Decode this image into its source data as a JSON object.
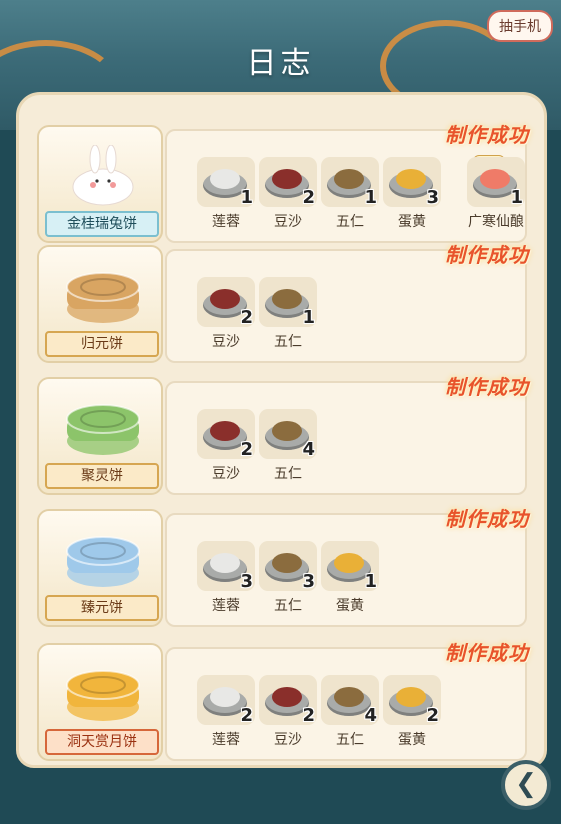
{
  "header": {
    "title": "日志",
    "phone_button": "抽手机"
  },
  "success_label": "制作成功",
  "extra_label": "额外",
  "rows": [
    {
      "cake": "金桂瑞兔饼",
      "label_style": "blue",
      "cake_icon": "rabbit-cake-icon",
      "items": [
        {
          "name": "莲蓉",
          "count": "1",
          "color": "#e8e8e6"
        },
        {
          "name": "豆沙",
          "count": "2",
          "color": "#8a2f2b"
        },
        {
          "name": "五仁",
          "count": "1",
          "color": "#8b6c3e"
        },
        {
          "name": "蛋黄",
          "count": "3",
          "color": "#e9b037"
        }
      ],
      "extra": {
        "name": "广寒仙酿",
        "count": "1",
        "color": "#ef7b68"
      }
    },
    {
      "cake": "归元饼",
      "label_style": "gold",
      "cake_icon": "mooncake-brown-icon",
      "items": [
        {
          "name": "豆沙",
          "count": "2",
          "color": "#8a2f2b"
        },
        {
          "name": "五仁",
          "count": "1",
          "color": "#8b6c3e"
        }
      ]
    },
    {
      "cake": "聚灵饼",
      "label_style": "gold",
      "cake_icon": "mooncake-green-icon",
      "items": [
        {
          "name": "豆沙",
          "count": "2",
          "color": "#8a2f2b"
        },
        {
          "name": "五仁",
          "count": "4",
          "color": "#8b6c3e"
        }
      ]
    },
    {
      "cake": "臻元饼",
      "label_style": "gold",
      "cake_icon": "mooncake-blue-icon",
      "items": [
        {
          "name": "莲蓉",
          "count": "3",
          "color": "#e8e8e6"
        },
        {
          "name": "五仁",
          "count": "3",
          "color": "#8b6c3e"
        },
        {
          "name": "蛋黄",
          "count": "1",
          "color": "#e9b037"
        }
      ]
    },
    {
      "cake": "洞天赏月饼",
      "label_style": "red",
      "cake_icon": "mooncake-golden-icon",
      "items": [
        {
          "name": "莲蓉",
          "count": "2",
          "color": "#e8e8e6"
        },
        {
          "name": "豆沙",
          "count": "2",
          "color": "#8a2f2b"
        },
        {
          "name": "五仁",
          "count": "4",
          "color": "#8b6c3e"
        },
        {
          "name": "蛋黄",
          "count": "2",
          "color": "#e9b037"
        }
      ]
    }
  ],
  "colors": {
    "rabbit": "#ffffff",
    "mooncake_brown": "#d9a562",
    "mooncake_green": "#8cc46a",
    "mooncake_blue": "#9fc9ea",
    "mooncake_golden": "#f1b53c"
  }
}
